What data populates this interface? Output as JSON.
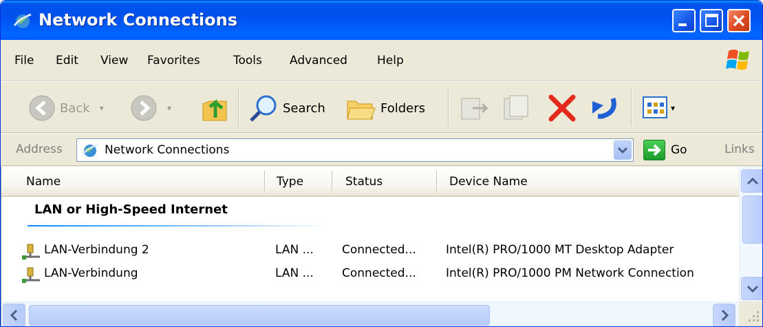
{
  "window": {
    "title": "Network Connections",
    "icon": "network-connections-icon"
  },
  "menu": {
    "items": [
      {
        "label": "File",
        "underline": "F"
      },
      {
        "label": "Edit",
        "underline": "E"
      },
      {
        "label": "View",
        "underline": "V"
      },
      {
        "label": "Favorites",
        "underline": "a"
      },
      {
        "label": "Tools",
        "underline": "T"
      },
      {
        "label": "Advanced",
        "underline": "n"
      },
      {
        "label": "Help",
        "underline": "H"
      }
    ]
  },
  "toolbar": {
    "back_label": "Back",
    "search_label": "Search",
    "folders_label": "Folders"
  },
  "address": {
    "label": "Address",
    "value": "Network Connections",
    "go_label": "Go",
    "links_label": "Links"
  },
  "list": {
    "columns": [
      "Name",
      "Type",
      "Status",
      "Device Name"
    ],
    "group_title": "LAN or High-Speed Internet",
    "rows": [
      {
        "name": "LAN-Verbindung 2",
        "type": "LAN ...",
        "status": "Connected...",
        "device": "Intel(R) PRO/1000 MT Desktop Adapter"
      },
      {
        "name": "LAN-Verbindung",
        "type": "LAN ...",
        "status": "Connected...",
        "device": "Intel(R) PRO/1000 PM Network Connection"
      }
    ]
  },
  "colors": {
    "titlebar": "#0053ee",
    "close": "#dd4a22",
    "chrome": "#ece9d8",
    "group_line": "#0a8bff"
  }
}
